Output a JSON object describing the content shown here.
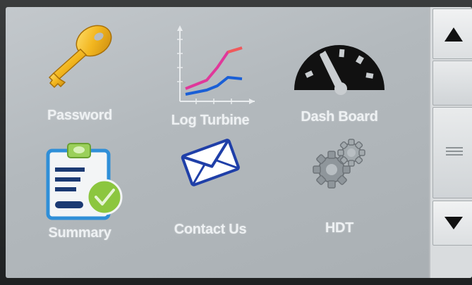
{
  "menu": {
    "tiles": [
      {
        "label": "Password",
        "icon": "key-icon"
      },
      {
        "label": "Log Turbine",
        "icon": "line-chart-icon"
      },
      {
        "label": "Dash Board",
        "icon": "gauge-icon"
      },
      {
        "label": "Summary",
        "icon": "clipboard-check-icon"
      },
      {
        "label": "Contact Us",
        "icon": "envelope-icon"
      },
      {
        "label": "HDT",
        "icon": "gears-icon"
      }
    ]
  },
  "scrollbar": {
    "up_icon": "triangle-up-icon",
    "down_icon": "triangle-down-icon",
    "thumb_icon": "grip-icon"
  },
  "colors": {
    "screen_bg": "#b8bec2",
    "label_text": "#eef1f3",
    "key_gold": "#f2b61f",
    "chart_pink": "#e0389a",
    "chart_blue": "#1a5fd6",
    "gauge_black": "#111111",
    "clipboard_blue": "#2f8fd8",
    "check_green": "#8cc63f",
    "gear_gray": "#8f969b"
  }
}
